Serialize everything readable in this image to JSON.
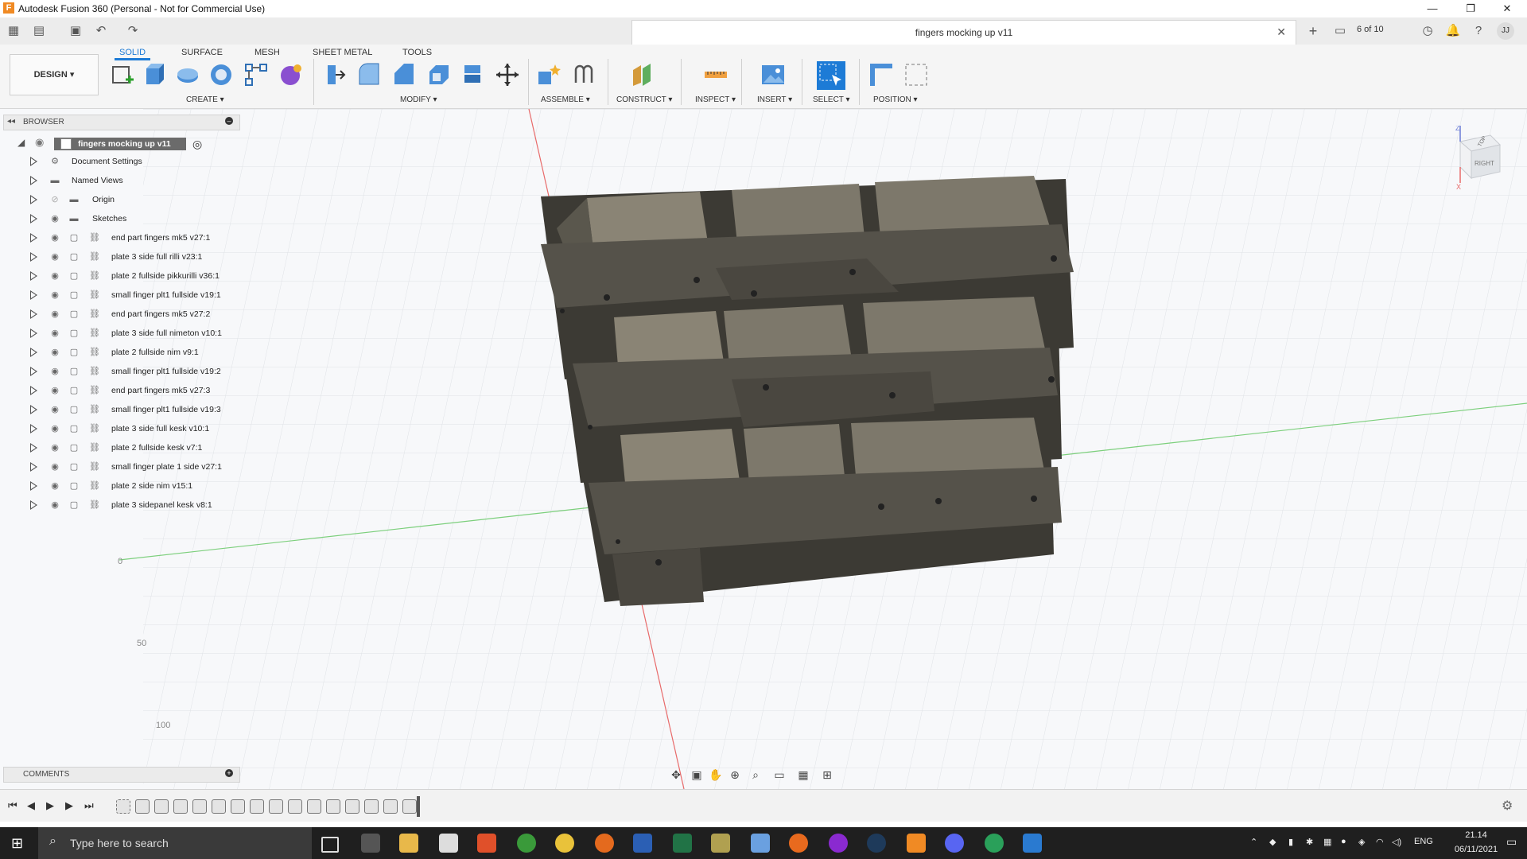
{
  "window": {
    "title": "Autodesk Fusion 360 (Personal - Not for Commercial Use)",
    "min": "—",
    "max": "❐",
    "close": "✕"
  },
  "tabbar": {
    "doc_title": "fingers mocking up v11",
    "close": "✕",
    "add": "+",
    "jobs": "6 of 10",
    "user": "JJ"
  },
  "toolbar": {
    "workspace": "DESIGN ▾",
    "tabs": [
      "SOLID",
      "SURFACE",
      "MESH",
      "SHEET METAL",
      "TOOLS"
    ],
    "groups": [
      "CREATE ▾",
      "MODIFY ▾",
      "ASSEMBLE ▾",
      "CONSTRUCT ▾",
      "INSPECT ▾",
      "INSERT ▾",
      "SELECT ▾",
      "POSITION ▾"
    ]
  },
  "browser": {
    "header": "BROWSER",
    "root": "fingers mocking up v11",
    "folders": [
      "Document Settings",
      "Named Views",
      "Origin",
      "Sketches"
    ],
    "components": [
      "end part fingers mk5 v27:1",
      "plate 3 side full rilli v23:1",
      "plate 2 fullside pikkurilli v36:1",
      "small finger plt1 fullside v19:1",
      "end part fingers mk5 v27:2",
      "plate 3 side full nimeton v10:1",
      "plate 2 fullside nim v9:1",
      "small finger plt1 fullside v19:2",
      "end part fingers mk5 v27:3",
      "small finger plt1 fullside v19:3",
      "plate 3 side full kesk v10:1",
      "plate 2 fullside kesk v7:1",
      "small finger  plate 1 side v27:1",
      "plate 2 side nim v15:1",
      "plate 3 sidepanel kesk v8:1"
    ]
  },
  "viewcube": {
    "top": "TOP",
    "right": "RIGHT",
    "z": "Z",
    "x": "X"
  },
  "grid_labels": [
    "0",
    "50",
    "100"
  ],
  "comments": {
    "header": "COMMENTS"
  },
  "taskbar": {
    "search_placeholder": "Type here to search",
    "lang": "ENG",
    "time": "21.14",
    "date": "06/11/2021"
  },
  "colors": {
    "accent": "#1d7bd6",
    "model_body": "#6e6a5f",
    "model_dark": "#3c3a34",
    "axis_red": "#e86a6a",
    "axis_green": "#7ccf7c"
  }
}
